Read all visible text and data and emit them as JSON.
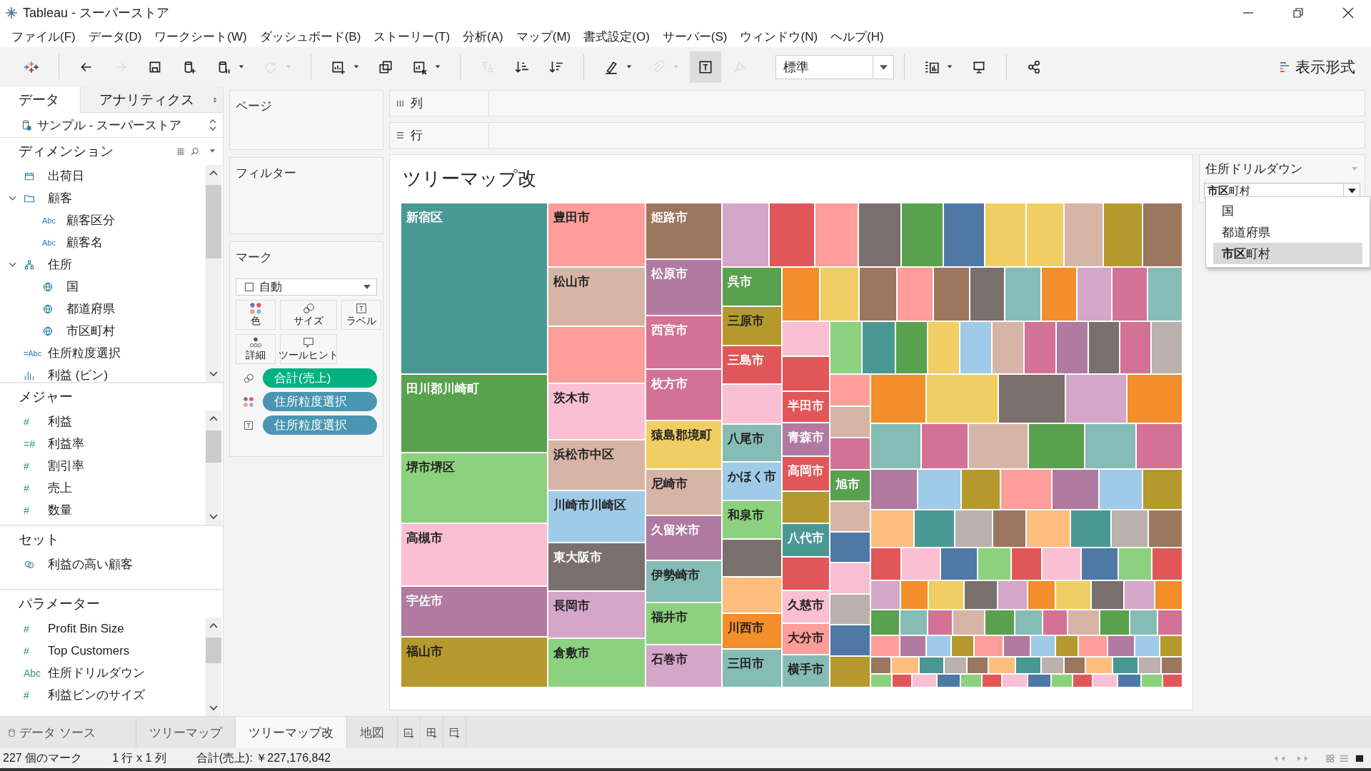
{
  "window": {
    "title": "Tableau - スーパーストア"
  },
  "menu": [
    "ファイル(F)",
    "データ(D)",
    "ワークシート(W)",
    "ダッシュボード(B)",
    "ストーリー(T)",
    "分析(A)",
    "マップ(M)",
    "書式設定(O)",
    "サーバー(S)",
    "ウィンドウ(N)",
    "ヘルプ(H)"
  ],
  "toolbar": {
    "buttons": [
      {
        "kind": "logo"
      },
      {
        "kind": "separator"
      },
      {
        "kind": "back",
        "disabled": false,
        "on": false,
        "dropdown": false
      },
      {
        "kind": "forward",
        "disabled": true,
        "on": false,
        "dropdown": false
      },
      {
        "kind": "save",
        "disabled": false,
        "on": false,
        "dropdown": false
      },
      {
        "kind": "new-datasource",
        "disabled": false,
        "on": false,
        "dropdown": false
      },
      {
        "kind": "pause-datasource",
        "disabled": false,
        "on": false,
        "dropdown": true
      },
      {
        "kind": "refresh",
        "disabled": true,
        "on": false,
        "dropdown": true
      },
      {
        "kind": "separator"
      },
      {
        "kind": "new-sheet",
        "disabled": false,
        "on": false,
        "dropdown": true
      },
      {
        "kind": "duplicate",
        "disabled": false,
        "on": false,
        "dropdown": false
      },
      {
        "kind": "clear",
        "disabled": false,
        "on": false,
        "dropdown": true
      },
      {
        "kind": "separator"
      },
      {
        "kind": "swap",
        "disabled": true,
        "on": false,
        "dropdown": false
      },
      {
        "kind": "sort-ascending",
        "disabled": false,
        "on": false,
        "dropdown": false
      },
      {
        "kind": "sort-descending",
        "disabled": false,
        "on": false,
        "dropdown": false
      },
      {
        "kind": "separator"
      },
      {
        "kind": "highlight",
        "disabled": false,
        "on": false,
        "dropdown": true
      },
      {
        "kind": "annotate",
        "disabled": true,
        "on": false,
        "dropdown": true
      },
      {
        "kind": "labels",
        "disabled": false,
        "on": true,
        "dropdown": false
      },
      {
        "kind": "pin",
        "disabled": true,
        "on": false,
        "dropdown": false
      },
      {
        "kind": "fit"
      },
      {
        "kind": "separator"
      },
      {
        "kind": "chart",
        "disabled": false,
        "on": false,
        "dropdown": true
      },
      {
        "kind": "presentation",
        "disabled": false,
        "on": false,
        "dropdown": false
      },
      {
        "kind": "separator"
      },
      {
        "kind": "share",
        "disabled": false,
        "on": false,
        "dropdown": false
      }
    ],
    "fit": "標準",
    "show_me": "表示形式"
  },
  "data_pane": {
    "tabs": [
      {
        "label": "データ",
        "selected": true
      },
      {
        "label": "アナリティクス",
        "selected": false
      }
    ],
    "datasource": "サンプル - スーパーストア",
    "sections": [
      {
        "kind": "dimension",
        "title": "ディメンション",
        "items": [
          {
            "name": "出荷日",
            "kind": "date"
          },
          {
            "name": "顧客",
            "kind": "folder",
            "expanded": true,
            "children": [
              {
                "name": "顧客区分",
                "kind": "text",
                "icon": "Abc"
              },
              {
                "name": "顧客名",
                "kind": "text",
                "icon": "Abc"
              }
            ]
          },
          {
            "name": "住所",
            "kind": "hierarchy",
            "expanded": true,
            "children": [
              {
                "name": "国",
                "kind": "geo"
              },
              {
                "name": "都道府県",
                "kind": "geo"
              },
              {
                "name": "市区町村",
                "kind": "geo"
              }
            ]
          },
          {
            "name": "住所粒度選択",
            "kind": "text",
            "icon": "=Abc"
          },
          {
            "name": "利益 (ビン)",
            "kind": "bin"
          }
        ]
      },
      {
        "kind": "measure",
        "title": "メジャー",
        "items": [
          {
            "name": "利益",
            "kind": "number",
            "icon": "#"
          },
          {
            "name": "利益率",
            "kind": "number",
            "icon": "=#"
          },
          {
            "name": "割引率",
            "kind": "number",
            "icon": "#"
          },
          {
            "name": "売上",
            "kind": "number",
            "icon": "#"
          },
          {
            "name": "数量",
            "kind": "number",
            "icon": "#"
          }
        ]
      },
      {
        "kind": "set",
        "title": "セット",
        "items": [
          {
            "name": "利益の高い顧客",
            "kind": "set"
          }
        ]
      },
      {
        "kind": "parameter",
        "title": "パラメーター",
        "items": [
          {
            "name": "Profit Bin Size",
            "kind": "number",
            "icon": "#"
          },
          {
            "name": "Top Customers",
            "kind": "number",
            "icon": "#"
          },
          {
            "name": "住所ドリルダウン",
            "kind": "text",
            "icon": "Abc"
          },
          {
            "name": "利益ビンのサイズ",
            "kind": "number",
            "icon": "#"
          }
        ]
      }
    ]
  },
  "pages_card": {
    "title": "ページ"
  },
  "filters_card": {
    "title": "フィルター"
  },
  "marks_card": {
    "title": "マーク",
    "mark_type": "自動",
    "buttons": [
      {
        "kind": "color",
        "label": "色"
      },
      {
        "kind": "size",
        "label": "サイズ"
      },
      {
        "kind": "label",
        "label": "ラベル"
      },
      {
        "kind": "detail",
        "label": "詳細"
      },
      {
        "kind": "tooltip",
        "label": "ツールヒント"
      }
    ],
    "pills": [
      {
        "kind": "size",
        "color": "#00b180",
        "label": "合計(売上)"
      },
      {
        "kind": "color",
        "color": "#4996b2",
        "label": "住所粒度選択"
      },
      {
        "kind": "label",
        "color": "#4996b2",
        "label": "住所粒度選択"
      }
    ]
  },
  "shelves": [
    {
      "kind": "columns",
      "label": "列"
    },
    {
      "kind": "rows",
      "label": "行"
    }
  ],
  "treemap": {
    "title": "ツリーマップ改",
    "tile_groups": [
      [
        {
          "label": "新宿区",
          "color": "#499894"
        },
        {
          "label": "田川郡川崎町",
          "color": "#59a14f"
        },
        {
          "label": "堺市堺区",
          "color": "#8cd17d"
        },
        {
          "label": "高槻市",
          "color": "#fabfd2"
        },
        {
          "label": "宇佐市",
          "color": "#b07aa1"
        },
        {
          "label": "福山市",
          "color": "#b6992d"
        }
      ],
      [
        {
          "label": "豊田市",
          "color": "#ff9d9a"
        },
        {
          "label": "松山市",
          "color": "#d7b5a6"
        },
        {
          "color": "#ff9d9a"
        },
        {
          "label": "茨木市",
          "color": "#fabfd2"
        },
        {
          "label": "浜松市中区",
          "color": "#d7b5a6"
        },
        {
          "label": "川崎市川崎区",
          "color": "#a0cbe8"
        },
        {
          "label": "東大阪市",
          "color": "#79706e"
        },
        {
          "label": "長岡市",
          "color": "#d4a6c8"
        },
        {
          "label": "倉敷市",
          "color": "#8cd17d"
        }
      ],
      [
        {
          "label": "姫路市",
          "color": "#9d7660"
        },
        {
          "label": "松原市",
          "color": "#b07aa1"
        },
        {
          "label": "西宮市",
          "color": "#d37295"
        },
        {
          "label": "枚方市",
          "color": "#d37295"
        },
        {
          "label": "猿島郡境町",
          "color": "#f1ce63"
        },
        {
          "label": "尼崎市",
          "color": "#d7b5a6"
        },
        {
          "label": "久留米市",
          "color": "#b07aa1"
        },
        {
          "label": "伊勢崎市",
          "color": "#86bcb6"
        },
        {
          "label": "福井市",
          "color": "#8cd17d"
        },
        {
          "label": "石巻市",
          "color": "#d4a6c8"
        }
      ],
      [
        {
          "color": "#d4a6c8"
        },
        {
          "color": "#e15759"
        },
        {
          "color": "#ff9d9a"
        },
        {
          "color": "#79706e"
        },
        {
          "color": "#59a14f"
        },
        {
          "color": "#4e79a7"
        },
        {
          "color": "#f1ce63"
        },
        {
          "color": "#f1ce63"
        },
        {
          "color": "#d7b5a6"
        },
        {
          "color": "#b6992d"
        },
        {
          "color": "#9d7660"
        }
      ],
      [
        {
          "label": "呉市",
          "color": "#59a14f"
        },
        {
          "label": "三原市",
          "color": "#b6992d"
        },
        {
          "label": "三島市",
          "color": "#e15759"
        },
        {
          "color": "#fabfd2"
        },
        {
          "label": "八尾市",
          "color": "#86bcb6"
        },
        {
          "label": "かほく市",
          "color": "#a0cbe8"
        },
        {
          "label": "和泉市",
          "color": "#8cd17d"
        },
        {
          "color": "#79706e"
        },
        {
          "color": "#ffbe7d"
        },
        {
          "label": "川西市",
          "color": "#f28e2b"
        },
        {
          "label": "三田市",
          "color": "#86bcb6"
        }
      ],
      [
        {
          "color": "#f28e2b"
        },
        {
          "color": "#f1ce63"
        },
        {
          "color": "#9d7660"
        },
        {
          "color": "#ff9d9a"
        },
        {
          "color": "#9d7660"
        },
        {
          "color": "#79706e"
        },
        {
          "color": "#86bcb6"
        },
        {
          "color": "#f28e2b"
        },
        {
          "color": "#d4a6c8"
        },
        {
          "color": "#d37295"
        },
        {
          "color": "#86bcb6"
        }
      ],
      [
        {
          "color": "#fabfd2"
        },
        {
          "color": "#e15759"
        },
        {
          "label": "半田市",
          "color": "#e15759"
        },
        {
          "label": "青森市",
          "color": "#b07aa1"
        },
        {
          "label": "高岡市",
          "color": "#e15759"
        },
        {
          "color": "#b6992d"
        },
        {
          "label": "八代市",
          "color": "#499894"
        },
        {
          "color": "#e15759"
        },
        {
          "label": "久慈市",
          "color": "#fabfd2"
        },
        {
          "label": "大分市",
          "color": "#ff9d9a"
        },
        {
          "label": "横手市",
          "color": "#86bcb6"
        }
      ],
      [
        {
          "color": "#8cd17d"
        },
        {
          "color": "#499894"
        },
        {
          "color": "#59a14f"
        },
        {
          "color": "#f1ce63"
        },
        {
          "color": "#a0cbe8"
        },
        {
          "color": "#d7b5a6"
        },
        {
          "color": "#d37295"
        },
        {
          "color": "#b07aa1"
        },
        {
          "color": "#79706e"
        },
        {
          "color": "#d37295"
        },
        {
          "color": "#bab0ac"
        }
      ],
      [
        {
          "color": "#ff9d9a"
        },
        {
          "color": "#d7b5a6"
        },
        {
          "color": "#d37295"
        },
        {
          "label": "旭市",
          "color": "#59a14f"
        },
        {
          "color": "#d7b5a6"
        },
        {
          "color": "#4e79a7"
        },
        {
          "color": "#fabfd2"
        },
        {
          "color": "#bab0ac"
        },
        {
          "color": "#4e79a7"
        },
        {
          "color": "#b6992d"
        }
      ]
    ]
  },
  "parameter_card": {
    "title": "住所ドリルダウン",
    "value": "**市区**町村",
    "options": [
      {
        "label": "国",
        "selected": false
      },
      {
        "label": "都道府県",
        "selected": false
      },
      {
        "label": "**市区**町村",
        "selected": true
      }
    ]
  },
  "sheet_tabs": [
    {
      "kind": "datasource",
      "label": "データ ソース",
      "selected": false
    },
    {
      "kind": "sheet",
      "label": "ツリーマップ",
      "selected": false
    },
    {
      "kind": "sheet",
      "label": "ツリーマップ改",
      "selected": true
    },
    {
      "kind": "sheet",
      "label": "地図",
      "selected": false
    }
  ],
  "status_bar": [
    "227 個のマーク",
    "1 行 x 1 列",
    "合計(売上): ￥227,176,842"
  ]
}
